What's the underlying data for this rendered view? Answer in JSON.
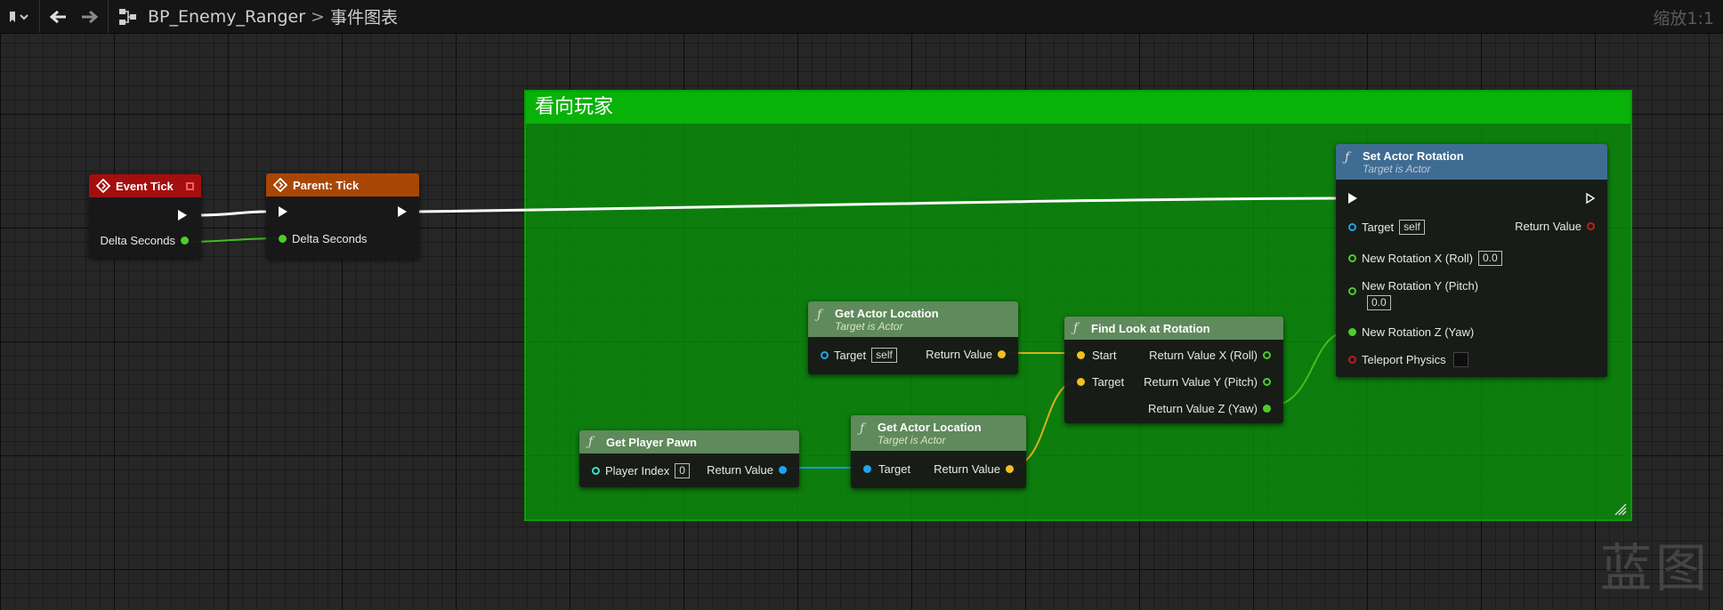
{
  "toolbar": {
    "blueprint_name": "BP_Enemy_Ranger",
    "separator": ">",
    "graph_name": "事件图表",
    "zoom_label": "缩放1:1"
  },
  "comment": {
    "title": "看向玩家",
    "color": "#09b209"
  },
  "nodes": {
    "event_tick": {
      "title": "Event Tick",
      "delta_seconds": "Delta Seconds",
      "color": "#a40e0e"
    },
    "parent_tick": {
      "title": "Parent: Tick",
      "delta_seconds": "Delta Seconds",
      "color": "#a84705"
    },
    "set_actor_rotation": {
      "title": "Set Actor Rotation",
      "subtitle": "Target is Actor",
      "target": "Target",
      "target_value": "self",
      "return_value": "Return Value",
      "rot_x": "New Rotation X (Roll)",
      "rot_x_value": "0.0",
      "rot_y": "New Rotation Y (Pitch)",
      "rot_y_value": "0.0",
      "rot_z": "New Rotation Z (Yaw)",
      "teleport": "Teleport Physics",
      "color": "#3f6c93"
    },
    "get_actor_location_1": {
      "title": "Get Actor Location",
      "subtitle": "Target is Actor",
      "target": "Target",
      "target_value": "self",
      "return_value": "Return Value",
      "color": "#5f8a5b"
    },
    "find_look_at_rotation": {
      "title": "Find Look at Rotation",
      "start": "Start",
      "target": "Target",
      "ret_x": "Return Value X (Roll)",
      "ret_y": "Return Value Y (Pitch)",
      "ret_z": "Return Value Z (Yaw)",
      "color": "#5f8a5b"
    },
    "get_player_pawn": {
      "title": "Get Player Pawn",
      "player_index": "Player Index",
      "player_index_value": "0",
      "return_value": "Return Value",
      "color": "#5f8a5b"
    },
    "get_actor_location_2": {
      "title": "Get Actor Location",
      "subtitle": "Target is Actor",
      "target": "Target",
      "return_value": "Return Value",
      "color": "#5f8a5b"
    }
  },
  "watermark": "蓝图"
}
